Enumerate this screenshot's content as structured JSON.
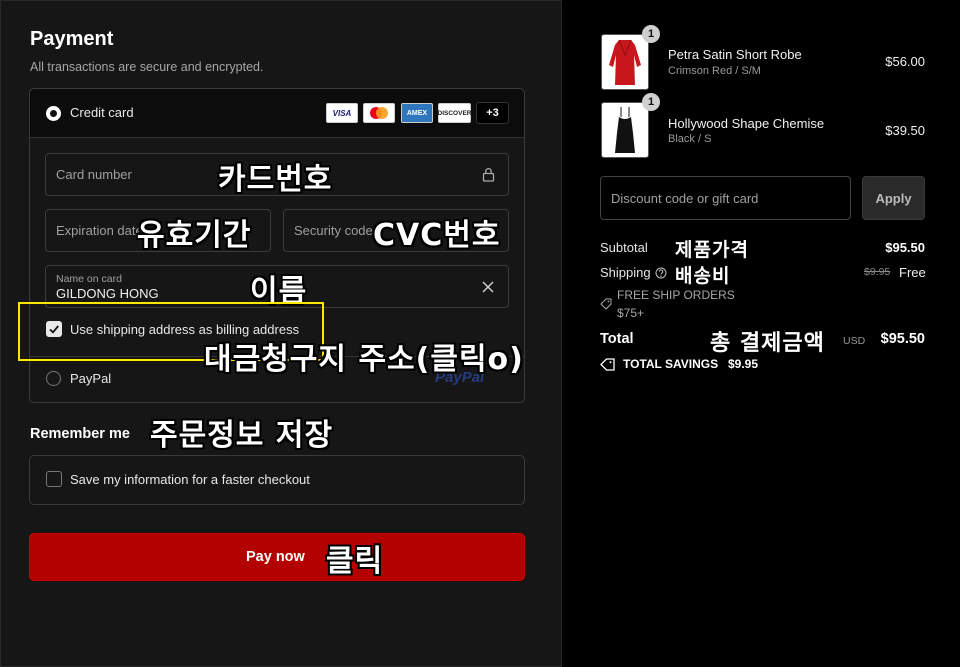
{
  "payment": {
    "title": "Payment",
    "subtitle": "All transactions are secure and encrypted.",
    "credit_card_label": "Credit card",
    "card_logos": [
      "VISA",
      "mastercard",
      "AMEX",
      "DISCOVER"
    ],
    "more_cards": "+3",
    "card_number_placeholder": "Card number",
    "expiration_placeholder": "Expiration date",
    "security_code_placeholder": "Security code",
    "name_on_card_label": "Name on card",
    "name_on_card_value": "GILDONG HONG",
    "billing_checkbox_label": "Use shipping address as billing address",
    "billing_checked": true,
    "paypal_label": "PayPal",
    "paypal_logo_text": "PayPal"
  },
  "remember": {
    "title": "Remember me",
    "save_label": "Save my information for a faster checkout",
    "save_checked": false
  },
  "pay_button": "Pay now",
  "annotations": {
    "card_number": "카드번호",
    "expiration": "유효기간",
    "cvc": "CVC번호",
    "name": "이름",
    "billing": "대금청구지 주소(클릭o)",
    "remember": "주문정보 저장",
    "pay": "클릭",
    "product_price": "제품가격",
    "shipping": "배송비",
    "total": "총 결제금액"
  },
  "cart": {
    "items": [
      {
        "name": "Petra Satin Short Robe",
        "variant": "Crimson Red / S/M",
        "price": "$56.00",
        "qty": "1"
      },
      {
        "name": "Hollywood Shape Chemise",
        "variant": "Black / S",
        "price": "$39.50",
        "qty": "1"
      }
    ],
    "discount_placeholder": "Discount code or gift card",
    "apply_label": "Apply",
    "subtotal_label": "Subtotal",
    "subtotal_value": "$95.50",
    "shipping_label": "Shipping",
    "shipping_original": "$9.95",
    "shipping_value": "Free",
    "free_ship_line1": "FREE SHIP ORDERS",
    "free_ship_line2": "$75+",
    "total_label": "Total",
    "total_currency": "USD",
    "total_value": "$95.50",
    "savings_label": "TOTAL SAVINGS",
    "savings_value": "$9.95"
  },
  "colors": {
    "pay_button": "#b30000",
    "annotation_box": "#ffe600",
    "paypal_blue": "#253b80"
  }
}
